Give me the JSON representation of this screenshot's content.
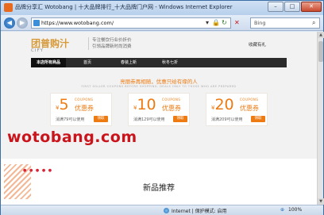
{
  "window": {
    "title": "品牌分享汇 Wotobang | 十大品牌排行_十大品牌门户网 - Windows Internet Explorer",
    "controls": {
      "minimize": "–",
      "maximize": "□",
      "close": "✕"
    }
  },
  "toolbar": {
    "back_glyph": "◀",
    "forward_glyph": "▶",
    "url": "https://www.wotobang.com/",
    "search_placeholder": "Bing",
    "icons": [
      "dropdown-icon",
      "lock-icon",
      "refresh-icon",
      "stop-icon",
      "search-icon"
    ]
  },
  "site": {
    "logo_text": "团普购汁",
    "logo_sub": "CIFY",
    "slogan_line1": "专注餐饮行业价折价",
    "slogan_line2": "引领品牌新时尚消费",
    "favorite_label": "收藏有礼",
    "nav": [
      {
        "label": "本店所有商品"
      },
      {
        "label": "首页"
      },
      {
        "label": "春装上新"
      },
      {
        "label": "秋冬七折"
      }
    ]
  },
  "banner": {
    "title": "亮丽券再相随，优惠只给有缘的人",
    "subtitle": "FIRST SOLLER COUPONS BEFORE SHOPPING. DEALS ONLY TO THOSE WHO ARE PREPARED"
  },
  "coupons": [
    {
      "currency": "¥",
      "amount": "5",
      "label": "COUPONS",
      "name": "优惠券",
      "condition": "消满79可以使用",
      "button": "领取"
    },
    {
      "currency": "¥",
      "amount": "10",
      "label": "COUPONS",
      "name": "优惠券",
      "condition": "消满129可以使用",
      "button": "领取"
    },
    {
      "currency": "¥",
      "amount": "20",
      "label": "COUPONS",
      "name": "优惠券",
      "condition": "消满209可以使用",
      "button": "领取"
    }
  ],
  "watermark": "wotobang.com",
  "decor_dots": "● ● ● ● ●",
  "section": {
    "title": "新品推荐"
  },
  "statusbar": {
    "zone": "Internet | 保护模式: 启用",
    "zoom": "100%"
  },
  "colors": {
    "accent": "#ee7a12",
    "watermark": "#c9141c",
    "nav_bg": "#2b2b2b"
  }
}
